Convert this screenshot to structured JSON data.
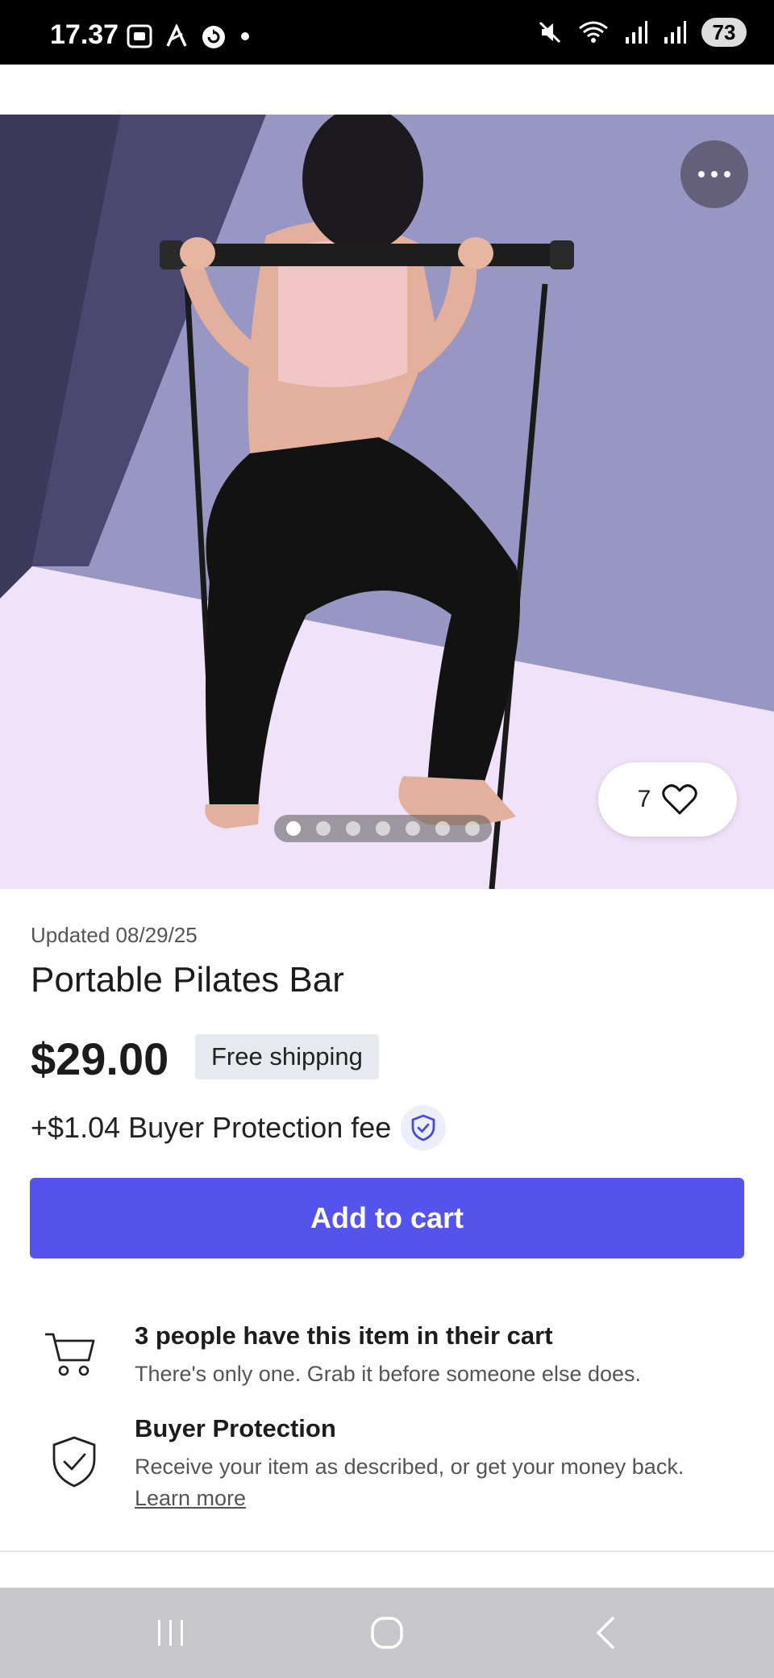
{
  "status_bar": {
    "time": "17.37",
    "battery": "73",
    "icons": [
      "screenshot-icon",
      "a-icon",
      "sync-icon",
      "dot-icon",
      "mute-icon",
      "wifi-icon",
      "signal-icon",
      "signal-icon"
    ]
  },
  "gallery": {
    "like_count": "7",
    "image_count": 7,
    "active_index": 0,
    "more_icon": "more-horizontal-icon",
    "like_icon": "heart-icon"
  },
  "product": {
    "updated": "Updated 08/29/25",
    "title": "Portable Pilates Bar",
    "price": "$29.00",
    "shipping_badge": "Free shipping",
    "fee_text": "+$1.04 Buyer Protection fee"
  },
  "actions": {
    "add_to_cart": "Add to cart"
  },
  "info": {
    "cart_title": "3 people have this item in their cart",
    "cart_desc": "There's only one. Grab it before someone else does.",
    "protection_title": "Buyer Protection",
    "protection_desc": "Receive your item as described, or get your money back.",
    "learn_more": "Learn more"
  },
  "colors": {
    "accent": "#5454ec",
    "status_bar": "#000000",
    "nav_bar": "#c7c7cb"
  }
}
